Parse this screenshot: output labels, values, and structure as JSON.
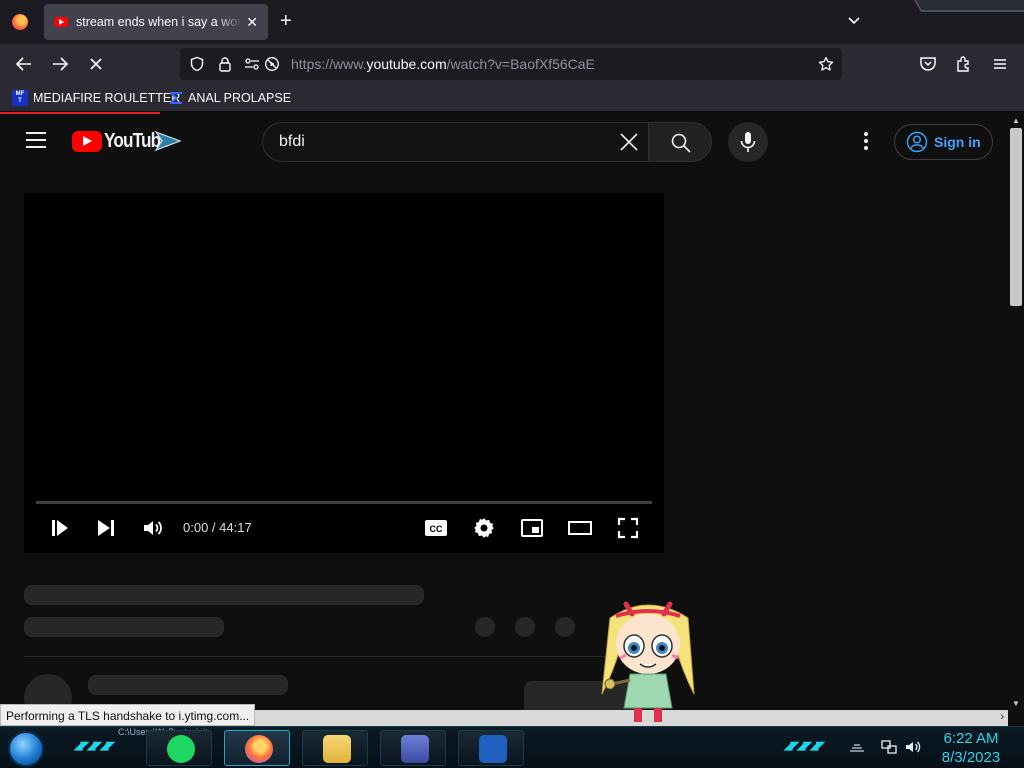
{
  "browser": {
    "tab_title": "stream ends when i say a word",
    "tab_close": "✕",
    "new_tab": "+",
    "url_prefix": "https://www.",
    "url_host": "youtube.com",
    "url_path": "/watch?v=BaofXf56CaE",
    "bookmarks": [
      {
        "label": "MEDIAFIRE ROULETTER",
        "icon": "mediafire-icon"
      },
      {
        "label": "ANAL PROLAPSE",
        "icon": "sigma-icon"
      }
    ],
    "status_text": "Performing a TLS handshake to i.ytimg.com..."
  },
  "youtube": {
    "logo_text": "YouTube",
    "search_query": "bfdi",
    "sign_in_label": "Sign in",
    "player": {
      "time_current": "0:00",
      "time_sep": " / ",
      "time_total": "44:17",
      "progress": 0
    }
  },
  "taskbar": {
    "cmd_snippet": "C:\\Users\\WsBoot.winit",
    "apps": [
      "spotify-icon",
      "firefox-icon",
      "file-explorer-icon",
      "control-panel-icon",
      "powershell-icon"
    ],
    "clock_time": "6:22 AM",
    "clock_date": "8/3/2023"
  },
  "colors": {
    "accent_blue": "#3ea6ff",
    "youtube_red": "#ff0000",
    "clock_cyan": "#2ad6ea"
  }
}
